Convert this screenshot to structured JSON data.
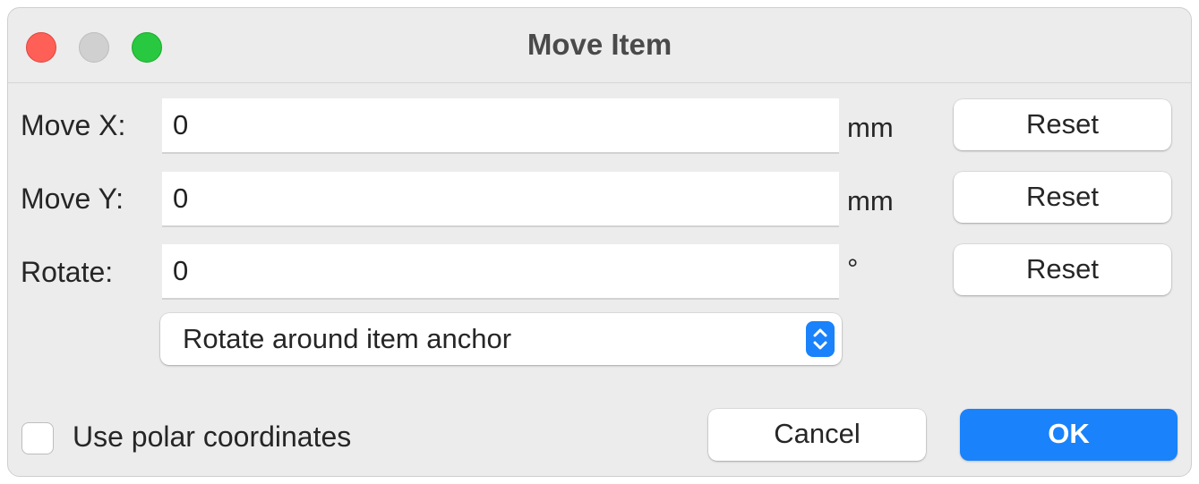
{
  "window": {
    "title": "Move Item"
  },
  "rows": [
    {
      "label": "Move X:",
      "value": "0",
      "unit": "mm",
      "reset_label": "Reset"
    },
    {
      "label": "Move Y:",
      "value": "0",
      "unit": "mm",
      "reset_label": "Reset"
    },
    {
      "label": "Rotate:",
      "value": "0",
      "unit": "°",
      "reset_label": "Reset"
    }
  ],
  "rotation_anchor": {
    "selected": "Rotate around item anchor"
  },
  "polar": {
    "label": "Use polar coordinates",
    "checked": false
  },
  "buttons": {
    "cancel": "Cancel",
    "ok": "OK"
  },
  "colors": {
    "accent": "#1a82fb",
    "close": "#fe5f57",
    "minimize_inactive": "#d0d0d0",
    "zoom": "#28c840"
  },
  "icons": {
    "select_arrows": "chevron-up-down-icon"
  }
}
